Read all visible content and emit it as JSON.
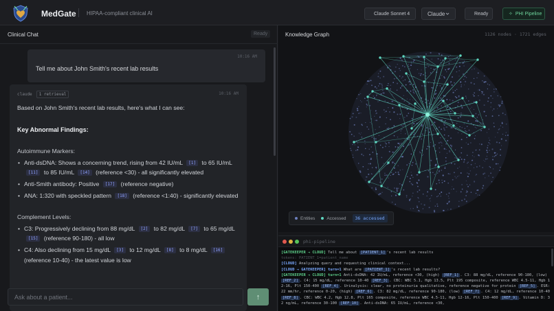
{
  "header": {
    "brand": "MedGate",
    "subtitle": "HIPAA-compliant clinical AI",
    "model_label": "Claude Sonnet 4",
    "provider_select": "Claude",
    "status": "Ready",
    "pipeline_button": "PHI Pipeline",
    "colors": {
      "ready": "#3fbf72",
      "pipeline": "#6fd49d",
      "model_dot": "#8d9097"
    },
    "icons": {
      "logo": "shield-heart-icon",
      "select": "chevron-down-icon",
      "pipeline": "sparkle-icon"
    }
  },
  "chat": {
    "title": "Clinical Chat",
    "status": "Ready",
    "user_message": {
      "time": "10:16 AM",
      "text": "Tell me about John Smith's recent lab results"
    },
    "ai_message": {
      "sender": "claude",
      "badge": "1 retrieval",
      "time": "10:16 AM",
      "intro": "Based on John Smith's recent lab results, here's what I can see:",
      "heading": "Key Abnormal Findings:",
      "sections": [
        {
          "title": "Autoimmune Markers:",
          "items": [
            [
              {
                "t": "Anti-dsDNA: Shows a concerning trend, rising from 42 IU/mL "
              },
              {
                "r": "[1]"
              },
              {
                "t": " to 65 IU/mL "
              },
              {
                "r": "[11]"
              },
              {
                "t": " to 85 IU/mL "
              },
              {
                "r": "[14]"
              },
              {
                "t": " (reference <30) - all significantly elevated"
              }
            ],
            [
              {
                "t": "Anti-Smith antibody: Positive "
              },
              {
                "r": "[17]"
              },
              {
                "t": " (reference negative)"
              }
            ],
            [
              {
                "t": "ANA: 1:320 with speckled pattern "
              },
              {
                "r": "[18]"
              },
              {
                "t": " (reference <1:40) - significantly elevated"
              }
            ]
          ]
        },
        {
          "title": "Complement Levels:",
          "items": [
            [
              {
                "t": "C3: Progressively declining from 88 mg/dL "
              },
              {
                "r": "[2]"
              },
              {
                "t": " to 82 mg/dL "
              },
              {
                "r": "[7]"
              },
              {
                "t": " to 65 mg/dL "
              },
              {
                "r": "[15]"
              },
              {
                "t": " (reference 90-180) - all low"
              }
            ],
            [
              {
                "t": "C4: Also declining from 15 mg/dL "
              },
              {
                "r": "[3]"
              },
              {
                "t": " to 12 mg/dL "
              },
              {
                "r": "[8]"
              },
              {
                "t": " to 8 mg/dL "
              },
              {
                "r": "[16]"
              },
              {
                "t": " (reference 10-40) - the latest value is low"
              }
            ]
          ]
        }
      ]
    },
    "input_placeholder": "Ask about a patient...",
    "send_icon": "arrow-up-icon"
  },
  "graph": {
    "title": "Knowledge Graph",
    "stats": "1126 nodes · 1721 edges",
    "legend": {
      "entities": "Entities",
      "accessed": "Accessed",
      "accessed_count": "36 accessed"
    },
    "colors": {
      "entity": "#6d7fbd",
      "accessed": "#5fd6c0",
      "edge": "#5fd6c0"
    }
  },
  "terminal": {
    "title": "phi-pipeline",
    "lines": [
      [
        {
          "c": "gk",
          "t": "[GATEKEEPER → CLOUD]"
        },
        {
          "t": " Tell me about "
        },
        {
          "c": "tk",
          "t": "[PATIENT_1]"
        },
        {
          "t": "'s recent lab results"
        }
      ],
      [
        {
          "c": "sub",
          "t": "tokens: PATIENT_1=patient_name"
        }
      ],
      [
        {
          "c": "cl",
          "t": "[CLOUD]"
        },
        {
          "t": " Analyzing query and requesting clinical context..."
        }
      ],
      [
        {
          "c": "cl",
          "t": "[CLOUD → GATEKEEPER] turn=1"
        },
        {
          "t": " What are "
        },
        {
          "c": "tk",
          "t": "[PATIENT_1]"
        },
        {
          "t": "'s recent lab results?"
        }
      ],
      [
        {
          "c": "gk",
          "t": "[GATEKEEPER → CLOUD] turn=1"
        },
        {
          "t": " Anti-dsDNA: 42 IU/mL, reference <30, (high) "
        },
        {
          "c": "tk",
          "t": "[REF_1]"
        },
        {
          "t": ". C3: 88 mg/dL, reference 90-180, (low) "
        },
        {
          "c": "tk",
          "t": "[REF_2]"
        },
        {
          "t": ". C4: 15 mg/dL, reference 10-40 "
        },
        {
          "c": "tk",
          "t": "[REF_3]"
        },
        {
          "t": ". CBC: WBC 5.1, Hgb 13.5, Plt 195 composite, reference WBC 4.5-11, Hgb 12-16, Plt 150-400 "
        },
        {
          "c": "tk",
          "t": "[REF_4]"
        },
        {
          "t": ". Urinalysis: clear, no proteinuria qualitative, reference negative for protein "
        },
        {
          "c": "tk",
          "t": "[REF_5]"
        },
        {
          "t": ". ESR: 22 mm/hr, reference 0-20, (high) "
        },
        {
          "c": "tk",
          "t": "[REF_6]"
        },
        {
          "t": ". C3: 82 mg/dL, reference 90-180, (low) "
        },
        {
          "c": "tk",
          "t": "[REF_7]"
        },
        {
          "t": ". C4: 12 mg/dL, reference 10-40 "
        },
        {
          "c": "tk",
          "t": "[REF_8]"
        },
        {
          "t": ". CBC: WBC 4.2, Hgb 12.8, Plt 165 composite, reference WBC 4.5-11, Hgb 12-16, Plt 150-400 "
        },
        {
          "c": "tk",
          "t": "[REF_9]"
        },
        {
          "t": ". Vitamin D: 32 ng/mL, reference 30-100 "
        },
        {
          "c": "tk",
          "t": "[REF_10]"
        },
        {
          "t": ". Anti-dsDNA: 65 IU/mL, reference <30,"
        }
      ]
    ]
  }
}
